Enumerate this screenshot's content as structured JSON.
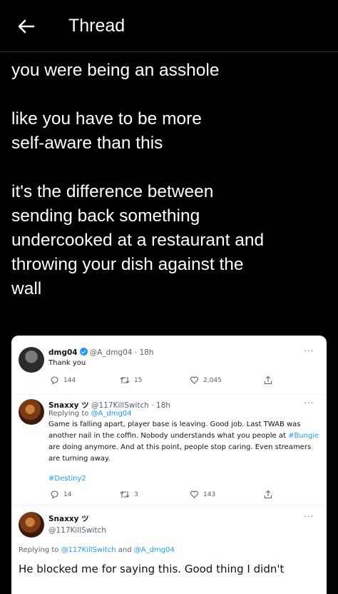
{
  "header": {
    "title": "Thread"
  },
  "post": {
    "line1": "you were being an asshole",
    "line2": "like you have to be more",
    "line3": "self-aware than this",
    "line4": "it's the difference between",
    "line5": "sending back something",
    "line6": "undercooked at a restaurant and",
    "line7": "throwing your dish against the",
    "line8": "wall"
  },
  "screenshot": {
    "tweet1": {
      "name": "dmg04",
      "handle_time": "@A_dmg04 · 18h",
      "text": "Thank you",
      "replies": "144",
      "retweets": "15",
      "likes": "2,045",
      "more": "···"
    },
    "tweet2": {
      "name": "Snaxxy ツ",
      "handle_time": "@117KillSwitch · 18h",
      "replying_prefix": "Replying to ",
      "replying_to": "@A_dmg04",
      "text_a": "Game is falling apart, player base is leaving. Good job. Last TWAB was",
      "text_b": "another nail in the coffin. Nobody understands what you people at ",
      "tag_bungie": "#Bungie",
      "text_c": "are doing anymore. And at this point, people stop caring. Even streamers",
      "text_d": "are turning away.",
      "tag_destiny": "#Destiny2",
      "replies": "14",
      "retweets": "3",
      "likes": "143",
      "more": "···"
    },
    "tweet3": {
      "name": "Snaxxy ツ",
      "handle": "@117KillSwitch",
      "replying_prefix": "Replying to ",
      "replying_a": "@117KillSwitch",
      "replying_and": " and ",
      "replying_b": "@A_dmg04",
      "text": "He blocked me for saying this. Good thing I didn't",
      "more": "···"
    }
  }
}
